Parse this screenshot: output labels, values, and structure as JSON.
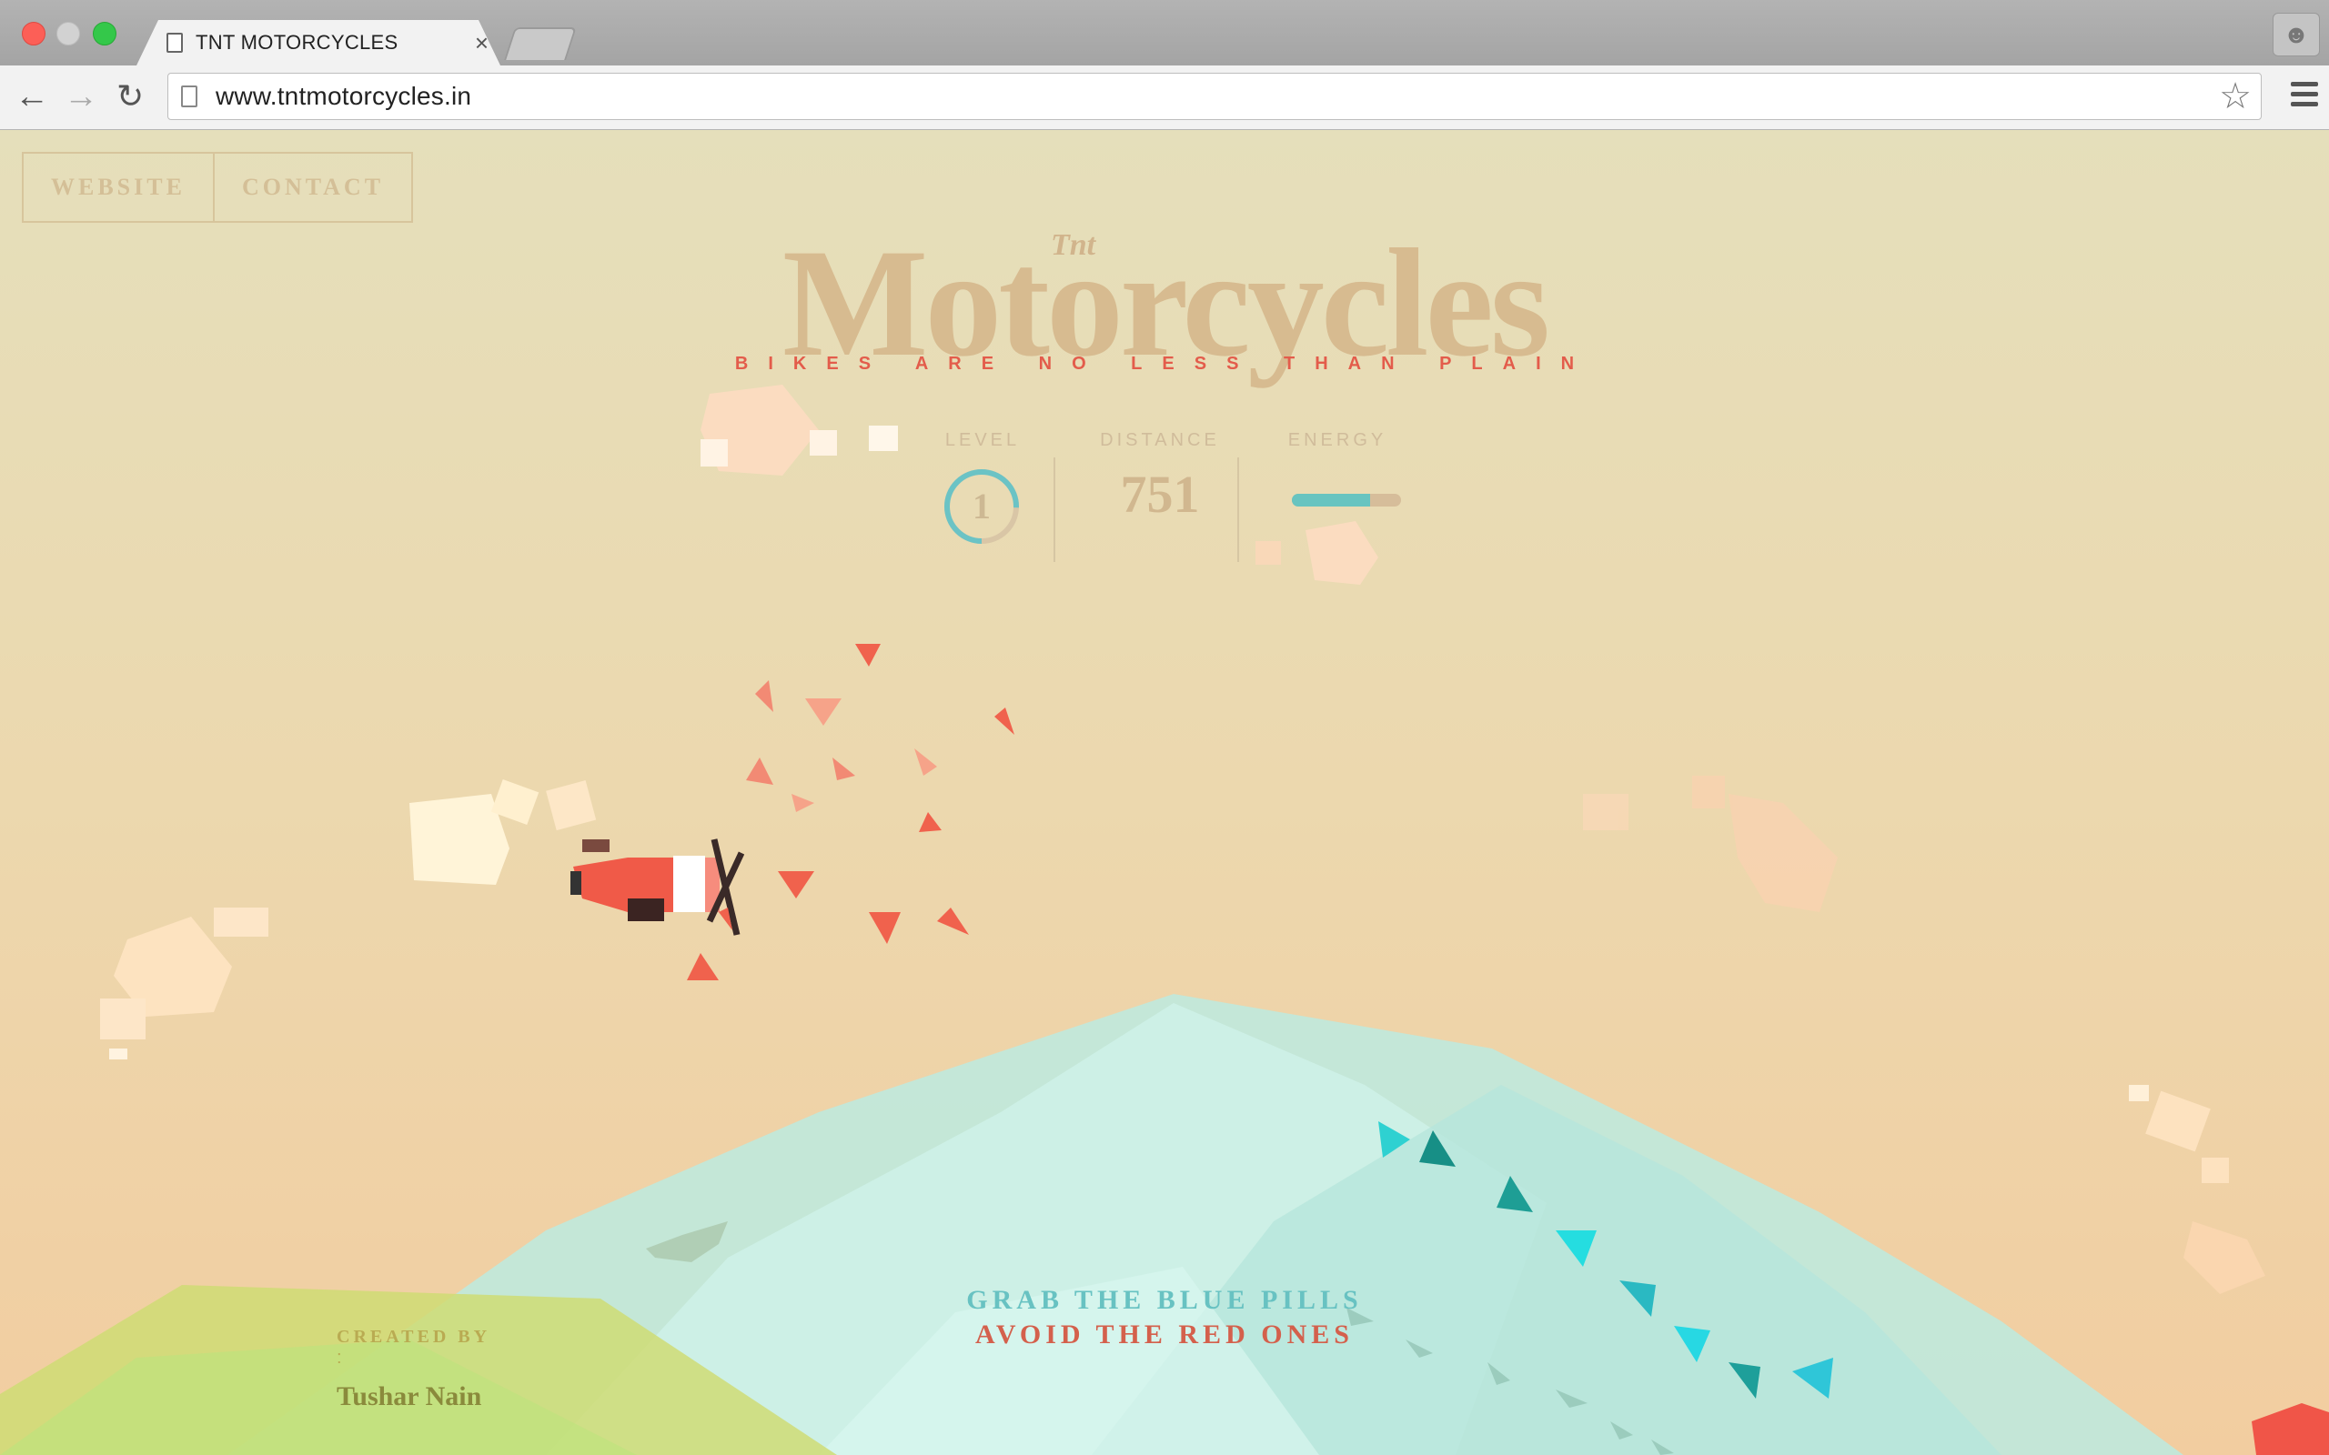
{
  "browser": {
    "tab_title": "TNT MOTORCYCLES",
    "tab_close": "×",
    "url": "www.tntmotorcycles.in",
    "icons": [
      "back-arrow-icon",
      "forward-arrow-icon",
      "reload-icon",
      "page-icon",
      "star-icon",
      "menu-icon",
      "profile-icon"
    ]
  },
  "nav": {
    "website": "WEBSITE",
    "contact": "CONTACT"
  },
  "header": {
    "brand_small": "Tnt",
    "brand": "Motorcycles",
    "tagline": "BIKES ARE NO LESS THAN PLAIN"
  },
  "stats": {
    "level_label": "LEVEL",
    "level_value": "1",
    "distance_label": "DISTANCE",
    "distance_value": "751",
    "energy_label": "ENERGY",
    "energy_fraction": 0.72
  },
  "instructions": {
    "line1": "GRAB THE BLUE PILLS",
    "line2": "AVOID THE RED ONES"
  },
  "credits": {
    "label": "CREATED BY",
    "colon": ":",
    "name": "Tushar Nain"
  },
  "colors": {
    "accent_red": "#e35c4b",
    "accent_teal": "#68c4c0",
    "brand_tan": "#d7bb90"
  }
}
